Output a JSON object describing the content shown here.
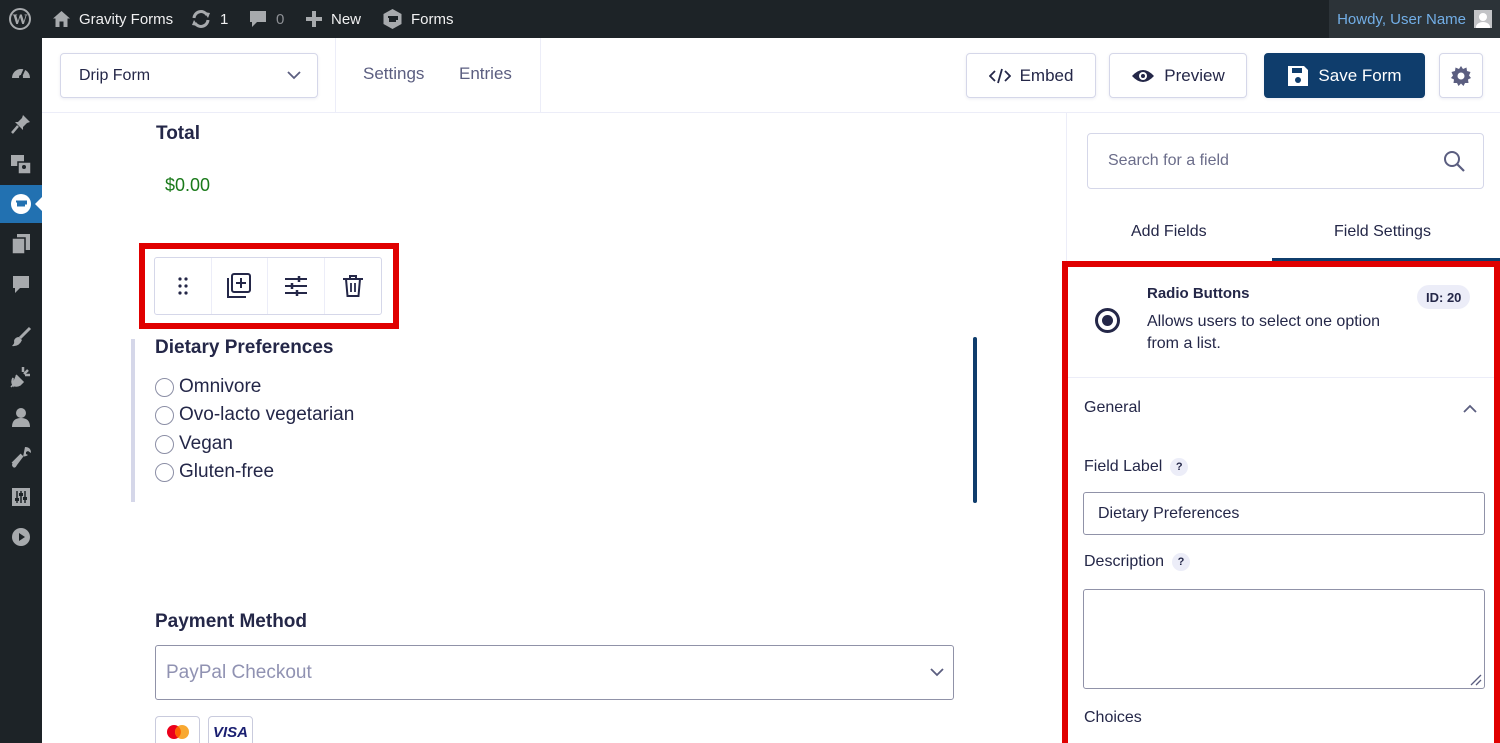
{
  "admin_bar": {
    "site_name": "Gravity Forms",
    "updates_count": "1",
    "comments_count": "0",
    "new_label": "New",
    "forms_label": "Forms",
    "howdy": "Howdy, User Name"
  },
  "toolbar": {
    "form_name": "Drip Form",
    "settings_label": "Settings",
    "entries_label": "Entries",
    "embed_label": "Embed",
    "preview_label": "Preview",
    "save_label": "Save Form"
  },
  "canvas": {
    "total_label": "Total",
    "total_value": "$0.00",
    "dietary_label": "Dietary Preferences",
    "dietary_options": [
      "Omnivore",
      "Ovo-lacto vegetarian",
      "Vegan",
      "Gluten-free"
    ],
    "payment_label": "Payment Method",
    "payment_placeholder": "PayPal Checkout",
    "cards": [
      "mastercard",
      "VISA"
    ]
  },
  "sidebar": {
    "search_placeholder": "Search for a field",
    "tabs": [
      "Add Fields",
      "Field Settings"
    ],
    "active_tab": "Field Settings",
    "field_type": "Radio Buttons",
    "field_desc": "Allows users to select one option from a list.",
    "field_id": "ID: 20",
    "section_general": "General",
    "field_label_title": "Field Label",
    "field_label_value": "Dietary Preferences",
    "description_title": "Description",
    "description_value": "",
    "choices_title": "Choices",
    "help_glyph": "?"
  },
  "colors": {
    "adminbar_bg": "#1d2327",
    "accent_blue": "#0f3d6c",
    "highlight_red": "#e00000",
    "price_green": "#1a7a1a"
  }
}
